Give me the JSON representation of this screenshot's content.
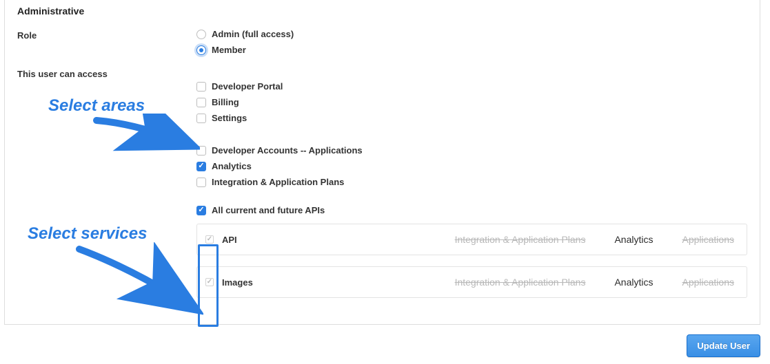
{
  "section_title": "Administrative",
  "labels": {
    "role": "Role",
    "access": "This user can access"
  },
  "role_options": {
    "admin": "Admin (full access)",
    "member": "Member",
    "selected": "member"
  },
  "access_checks": {
    "developer_portal": {
      "label": "Developer Portal",
      "checked": false
    },
    "billing": {
      "label": "Billing",
      "checked": false
    },
    "settings": {
      "label": "Settings",
      "checked": false
    },
    "developer_accounts": {
      "label": "Developer Accounts -- Applications",
      "checked": false
    },
    "analytics": {
      "label": "Analytics",
      "checked": true
    },
    "integration": {
      "label": "Integration & Application Plans",
      "checked": false
    },
    "all_apis": {
      "label": "All current and future APIs",
      "checked": true
    }
  },
  "services": [
    {
      "name": "API",
      "checked": true,
      "perms": {
        "integration": {
          "label": "Integration & Application Plans",
          "enabled": false
        },
        "analytics": {
          "label": "Analytics",
          "enabled": true
        },
        "applications": {
          "label": "Applications",
          "enabled": false
        }
      }
    },
    {
      "name": "Images",
      "checked": true,
      "perms": {
        "integration": {
          "label": "Integration & Application Plans",
          "enabled": false
        },
        "analytics": {
          "label": "Analytics",
          "enabled": true
        },
        "applications": {
          "label": "Applications",
          "enabled": false
        }
      }
    }
  ],
  "annotations": {
    "select_areas": "Select areas",
    "select_services": "Select services"
  },
  "buttons": {
    "update": "Update User"
  }
}
